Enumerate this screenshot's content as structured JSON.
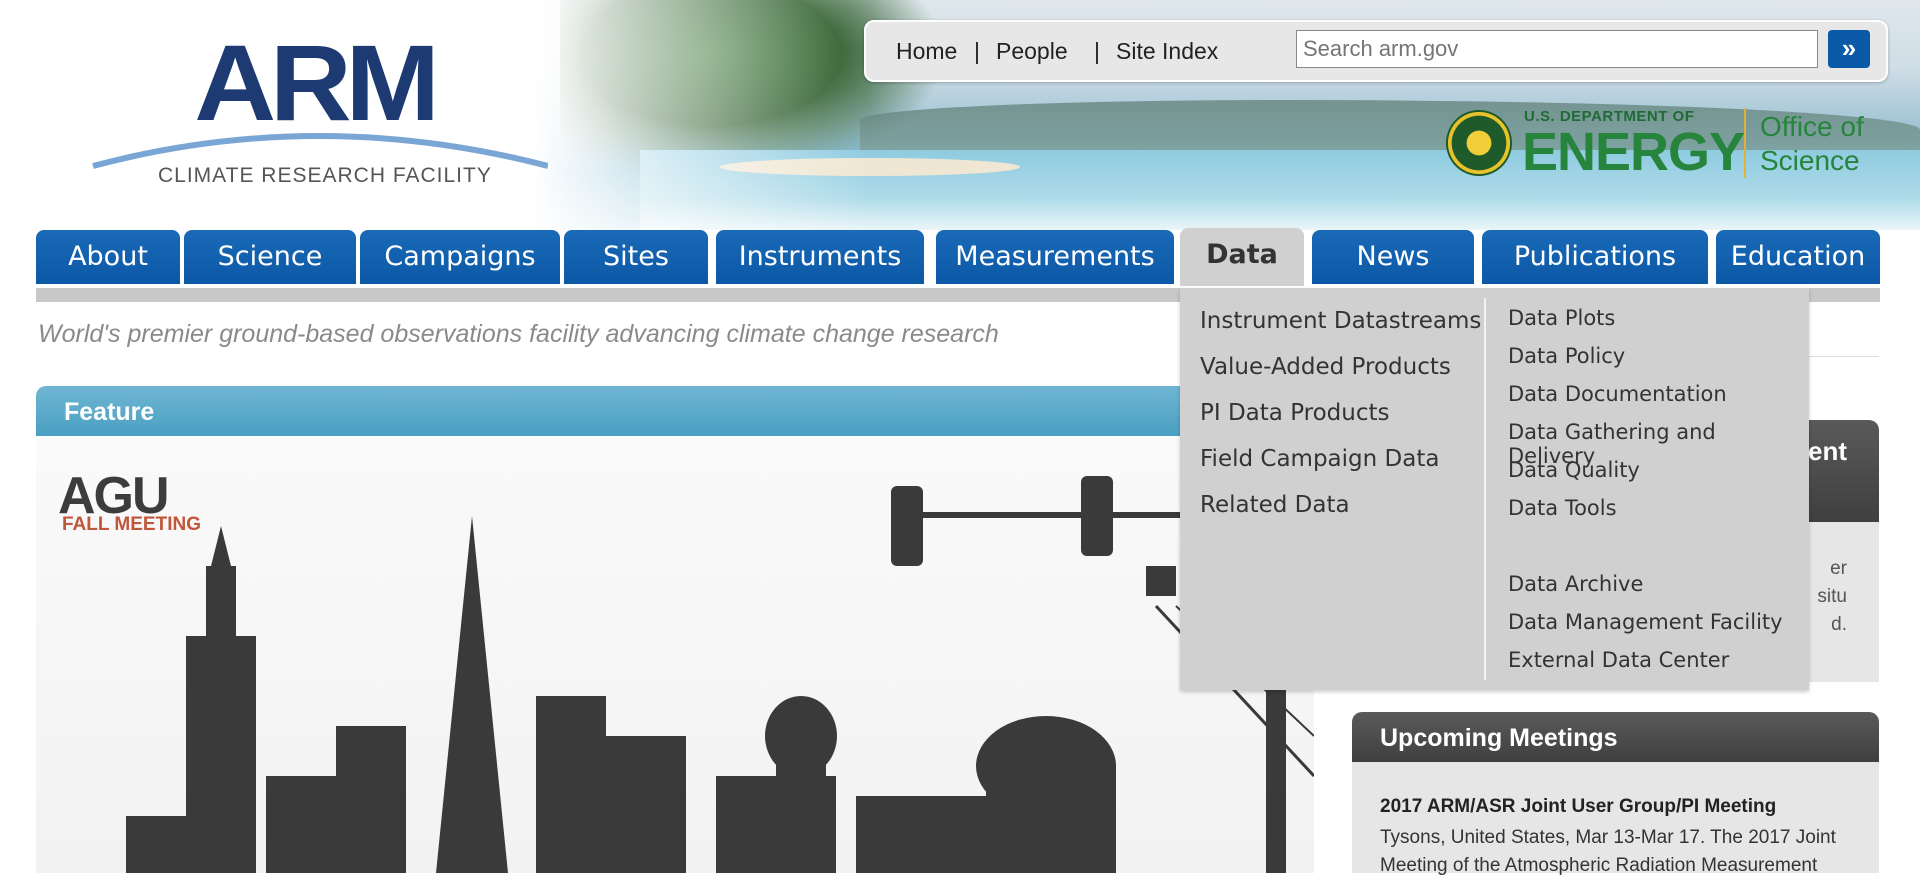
{
  "header": {
    "logo": {
      "name": "ARM",
      "subtitle": "CLIMATE RESEARCH FACILITY"
    },
    "toplinks": [
      "Home",
      "People",
      "Site Index"
    ],
    "separator": "|",
    "search": {
      "placeholder": "Search arm.gov",
      "button_icon": "double-chevron-right-icon",
      "button_glyph": "»"
    },
    "doe": {
      "small": "U.S. DEPARTMENT OF",
      "big": "ENERGY",
      "office_line1": "Office of",
      "office_line2": "Science"
    }
  },
  "nav": {
    "items": [
      "About",
      "Science",
      "Campaigns",
      "Sites",
      "Instruments",
      "Measurements",
      "Data",
      "News",
      "Publications",
      "Education"
    ],
    "active": "Data"
  },
  "tagline": "World's premier ground-based observations facility advancing climate change research",
  "feature": {
    "title": "Feature",
    "logo_word": "AGU",
    "logo_sub": "FALL MEETING"
  },
  "sidebar": {
    "panel1": {
      "title_fragment": "ent",
      "lines": [
        "er",
        "situ",
        "d."
      ]
    },
    "panel2": {
      "title": "Upcoming Meetings",
      "meeting_title": "2017 ARM/ASR Joint User Group/PI Meeting",
      "meeting_desc": "Tysons, United States, Mar 13-Mar 17. The 2017 Joint Meeting of the Atmospheric Radiation Measurement"
    }
  },
  "dropdown": {
    "left": [
      "Instrument Datastreams",
      "Value-Added Products",
      "PI Data Products",
      "Field Campaign Data",
      "Related Data"
    ],
    "right_top": [
      "Data Plots",
      "Data Policy",
      "Data Documentation",
      "Data Gathering and Delivery",
      "Data Quality",
      "Data Tools"
    ],
    "right_bottom": [
      "Data Archive",
      "Data Management Facility",
      "External Data Center"
    ]
  },
  "colors": {
    "nav_blue": "#0b58a6",
    "arm_navy": "#1d3a72",
    "doe_green": "#26843d",
    "feature_blue": "#4a9fc2",
    "panel_dark": "#3f3f3f"
  }
}
